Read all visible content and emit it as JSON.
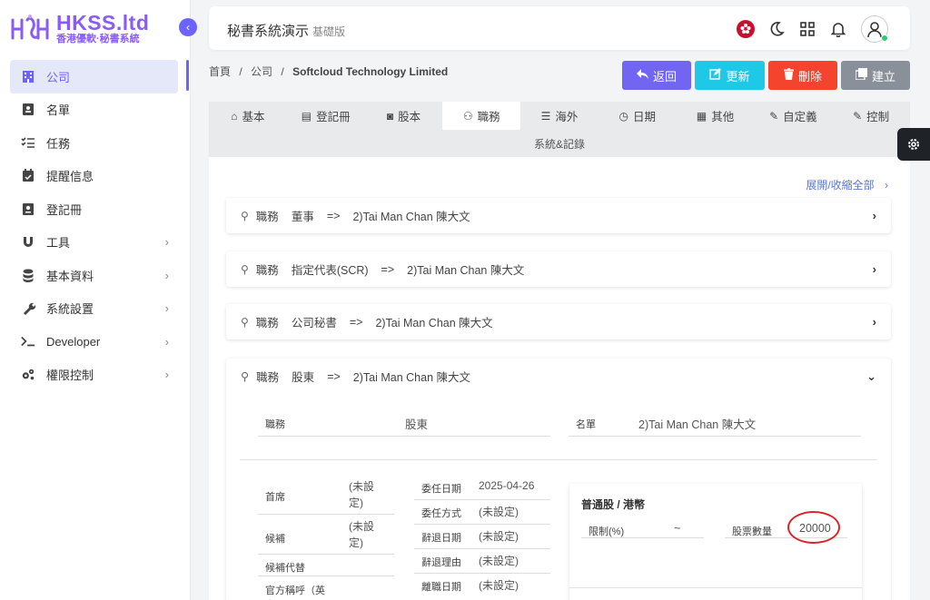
{
  "brand": {
    "title": "HKSS.ltd",
    "subtitle": "香港優軟·秘書系統"
  },
  "sidebar": {
    "items": [
      {
        "label": "公司",
        "icon": "building-icon",
        "active": true
      },
      {
        "label": "名單",
        "icon": "contact-card-icon"
      },
      {
        "label": "任務",
        "icon": "checklist-icon"
      },
      {
        "label": "提醒信息",
        "icon": "calendar-check-icon"
      },
      {
        "label": "登記冊",
        "icon": "register-book-icon"
      },
      {
        "label": "工具",
        "icon": "magnet-icon",
        "has_children": true
      },
      {
        "label": "基本資料",
        "icon": "database-icon",
        "has_children": true
      },
      {
        "label": "系統設置",
        "icon": "wrench-icon",
        "has_children": true
      },
      {
        "label": "Developer",
        "icon": "terminal-icon",
        "has_children": true
      },
      {
        "label": "權限控制",
        "icon": "gears-icon",
        "has_children": true
      }
    ]
  },
  "header": {
    "title": "秘書系統演示",
    "edition": "基礎版"
  },
  "breadcrumb": {
    "home": "首頁",
    "sep": "/",
    "section": "公司",
    "current": "Softcloud Technology Limited"
  },
  "actions": [
    {
      "label": "返回",
      "icon": "reply-icon",
      "color": "#7165f2"
    },
    {
      "label": "更新",
      "icon": "edit-icon",
      "color": "#1ec8e6"
    },
    {
      "label": "刪除",
      "icon": "trash-icon",
      "color": "#f5442e"
    },
    {
      "label": "建立",
      "icon": "copy-icon",
      "color": "#8a9099"
    }
  ],
  "tabs": [
    {
      "label": "基本",
      "icon": "home-icon"
    },
    {
      "label": "登記冊",
      "icon": "document-icon"
    },
    {
      "label": "股本",
      "icon": "money-icon"
    },
    {
      "label": "職務",
      "icon": "users-icon",
      "active": true
    },
    {
      "label": "海外",
      "icon": "server-icon"
    },
    {
      "label": "日期",
      "icon": "clock-icon"
    },
    {
      "label": "其他",
      "icon": "grid-icon"
    },
    {
      "label": "自定義",
      "icon": "user-edit-icon"
    },
    {
      "label": "控制",
      "icon": "user-edit-icon"
    }
  ],
  "tab_row2": "系統&記錄",
  "expand_all": "展開/收縮全部",
  "positions": [
    {
      "prefix": "職務",
      "role": "董事",
      "arrow": "=>",
      "person": "2)Tai Man Chan 陳大文",
      "expanded": false
    },
    {
      "prefix": "職務",
      "role": "指定代表(SCR)",
      "arrow": "=>",
      "person": "2)Tai Man Chan 陳大文",
      "expanded": false
    },
    {
      "prefix": "職務",
      "role": "公司秘書",
      "arrow": "=>",
      "person": "2)Tai Man Chan 陳大文",
      "expanded": false
    },
    {
      "prefix": "職務",
      "role": "股東",
      "arrow": "=>",
      "person": "2)Tai Man Chan 陳大文",
      "expanded": true
    }
  ],
  "detail": {
    "role_label": "職務",
    "role_value": "股東",
    "name_label": "名單",
    "name_value": "2)Tai Man Chan 陳大文",
    "left_fields": [
      {
        "label": "首席",
        "value": "(未設定)"
      },
      {
        "label": "候補",
        "value": "(未設定)"
      },
      {
        "label": "候補代替",
        "value": ""
      },
      {
        "label": "官方稱呼（英文）",
        "value": ""
      }
    ],
    "mid_fields": [
      {
        "label": "委任日期",
        "value": "2025-04-26"
      },
      {
        "label": "委任方式",
        "value": "(未設定)"
      },
      {
        "label": "辭退日期",
        "value": "(未設定)"
      },
      {
        "label": "辭退理由",
        "value": "(未設定)"
      },
      {
        "label": "離職日期",
        "value": "(未設定)"
      }
    ],
    "share_card": {
      "title": "普通股 / 港幣",
      "limit_label": "限制(%)",
      "limit_value": "~",
      "qty_label": "股票數量",
      "qty_value": "20000"
    }
  }
}
